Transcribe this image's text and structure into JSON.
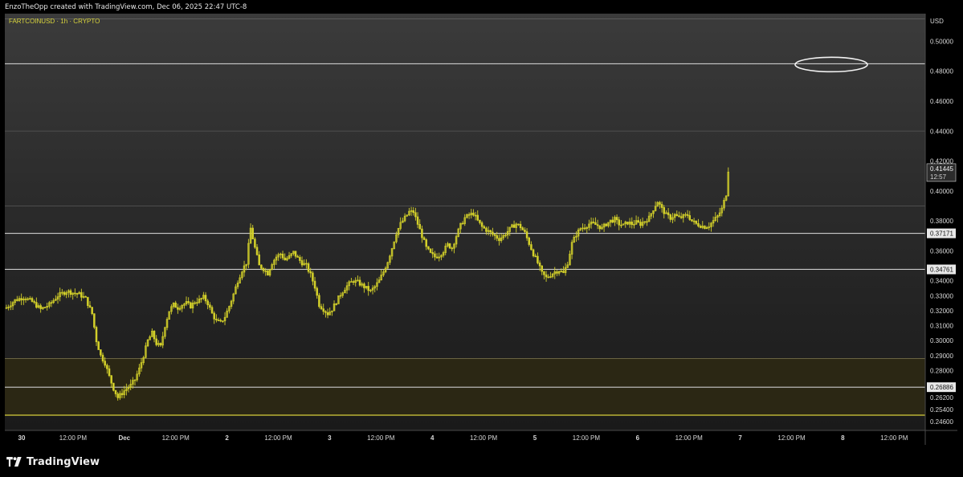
{
  "header": {
    "caption": "EnzoTheOpp created with TradingView.com, Dec 06, 2025 22:47 UTC-8"
  },
  "brand": {
    "name": "TradingView",
    "logo_icon": "tradingview-logo-icon"
  },
  "colors": {
    "candle": "#d4d12a",
    "zone": "#2b2714",
    "zone_edge": "#d8cf3a",
    "level_line": "#c9c9c9",
    "axis_text": "#d8d8d8",
    "symbol_text": "#d8d43c"
  },
  "chart_data": {
    "type": "candlestick",
    "symbol_label": "FARTCOINUSD · 1h · CRYPTO",
    "currency": "USD",
    "ylim": [
      0.24,
      0.5185
    ],
    "y_ticks": [
      "0.50000",
      "0.48000",
      "0.46000",
      "0.44000",
      "0.42000",
      "0.40000",
      "0.38000",
      "0.36000",
      "0.34000",
      "0.33000",
      "0.32000",
      "0.31000",
      "0.30000",
      "0.29000",
      "0.28000",
      "0.26200",
      "0.25400",
      "0.24600"
    ],
    "x_ticks": [
      "30",
      "12:00 PM",
      "Dec",
      "12:00 PM",
      "2",
      "12:00 PM",
      "3",
      "12:00 PM",
      "4",
      "12:00 PM",
      "5",
      "12:00 PM",
      "6",
      "12:00 PM",
      "7",
      "12:00 PM",
      "8",
      "12:00 PM"
    ],
    "current_price": {
      "price": "0.41445",
      "countdown": "12:57",
      "value": 0.41445
    },
    "level_lines": [
      {
        "price": 0.485,
        "label": ""
      },
      {
        "price": 0.3717,
        "label": "0.37171"
      },
      {
        "price": 0.3476,
        "label": "0.34761"
      },
      {
        "price": 0.2689,
        "label": "0.26886"
      }
    ],
    "demand_zone": {
      "top": 0.288,
      "bottom": 0.2502
    },
    "target_ellipse_price": 0.4845,
    "price_path": [
      [
        0,
        0.322
      ],
      [
        4,
        0.327
      ],
      [
        8,
        0.329
      ],
      [
        12,
        0.326
      ],
      [
        16,
        0.321
      ],
      [
        20,
        0.324
      ],
      [
        24,
        0.33
      ],
      [
        28,
        0.333
      ],
      [
        31,
        0.332
      ],
      [
        34,
        0.331
      ],
      [
        37,
        0.328
      ],
      [
        40,
        0.318
      ],
      [
        42,
        0.3
      ],
      [
        44,
        0.29
      ],
      [
        46,
        0.285
      ],
      [
        48,
        0.276
      ],
      [
        50,
        0.268
      ],
      [
        52,
        0.262
      ],
      [
        54,
        0.265
      ],
      [
        56,
        0.268
      ],
      [
        58,
        0.27
      ],
      [
        60,
        0.274
      ],
      [
        62,
        0.281
      ],
      [
        64,
        0.29
      ],
      [
        66,
        0.3
      ],
      [
        68,
        0.305
      ],
      [
        70,
        0.298
      ],
      [
        72,
        0.296
      ],
      [
        74,
        0.31
      ],
      [
        76,
        0.32
      ],
      [
        78,
        0.324
      ],
      [
        80,
        0.322
      ],
      [
        82,
        0.324
      ],
      [
        84,
        0.325
      ],
      [
        86,
        0.323
      ],
      [
        88,
        0.326
      ],
      [
        90,
        0.327
      ],
      [
        92,
        0.329
      ],
      [
        94,
        0.325
      ],
      [
        96,
        0.318
      ],
      [
        98,
        0.313
      ],
      [
        100,
        0.312
      ],
      [
        102,
        0.316
      ],
      [
        104,
        0.323
      ],
      [
        106,
        0.331
      ],
      [
        108,
        0.34
      ],
      [
        110,
        0.347
      ],
      [
        112,
        0.352
      ],
      [
        114,
        0.375
      ],
      [
        116,
        0.362
      ],
      [
        118,
        0.35
      ],
      [
        120,
        0.348
      ],
      [
        122,
        0.345
      ],
      [
        124,
        0.352
      ],
      [
        126,
        0.356
      ],
      [
        128,
        0.358
      ],
      [
        130,
        0.354
      ],
      [
        132,
        0.356
      ],
      [
        134,
        0.359
      ],
      [
        136,
        0.355
      ],
      [
        138,
        0.352
      ],
      [
        140,
        0.35
      ],
      [
        142,
        0.344
      ],
      [
        144,
        0.336
      ],
      [
        146,
        0.324
      ],
      [
        148,
        0.321
      ],
      [
        150,
        0.318
      ],
      [
        152,
        0.321
      ],
      [
        154,
        0.326
      ],
      [
        156,
        0.331
      ],
      [
        158,
        0.335
      ],
      [
        160,
        0.338
      ],
      [
        162,
        0.34
      ],
      [
        164,
        0.339
      ],
      [
        166,
        0.337
      ],
      [
        168,
        0.335
      ],
      [
        170,
        0.333
      ],
      [
        172,
        0.336
      ],
      [
        174,
        0.34
      ],
      [
        176,
        0.346
      ],
      [
        178,
        0.353
      ],
      [
        180,
        0.362
      ],
      [
        182,
        0.372
      ],
      [
        184,
        0.378
      ],
      [
        186,
        0.382
      ],
      [
        188,
        0.386
      ],
      [
        190,
        0.386
      ],
      [
        192,
        0.378
      ],
      [
        194,
        0.37
      ],
      [
        196,
        0.362
      ],
      [
        198,
        0.358
      ],
      [
        200,
        0.356
      ],
      [
        202,
        0.357
      ],
      [
        204,
        0.36
      ],
      [
        206,
        0.364
      ],
      [
        208,
        0.362
      ],
      [
        210,
        0.37
      ],
      [
        212,
        0.377
      ],
      [
        214,
        0.382
      ],
      [
        216,
        0.384
      ],
      [
        218,
        0.385
      ],
      [
        220,
        0.38
      ],
      [
        222,
        0.376
      ],
      [
        224,
        0.374
      ],
      [
        226,
        0.372
      ],
      [
        228,
        0.37
      ],
      [
        230,
        0.368
      ],
      [
        232,
        0.37
      ],
      [
        234,
        0.373
      ],
      [
        236,
        0.376
      ],
      [
        238,
        0.378
      ],
      [
        240,
        0.376
      ],
      [
        242,
        0.372
      ],
      [
        244,
        0.365
      ],
      [
        246,
        0.358
      ],
      [
        248,
        0.352
      ],
      [
        250,
        0.345
      ],
      [
        252,
        0.342
      ],
      [
        254,
        0.344
      ],
      [
        256,
        0.346
      ],
      [
        258,
        0.347
      ],
      [
        260,
        0.345
      ],
      [
        262,
        0.352
      ],
      [
        264,
        0.365
      ],
      [
        266,
        0.371
      ],
      [
        268,
        0.375
      ],
      [
        270,
        0.376
      ],
      [
        272,
        0.378
      ],
      [
        274,
        0.378
      ],
      [
        276,
        0.377
      ],
      [
        278,
        0.375
      ],
      [
        280,
        0.378
      ],
      [
        282,
        0.38
      ],
      [
        284,
        0.381
      ],
      [
        286,
        0.378
      ],
      [
        288,
        0.377
      ],
      [
        290,
        0.379
      ],
      [
        292,
        0.378
      ],
      [
        294,
        0.379
      ],
      [
        296,
        0.378
      ],
      [
        298,
        0.38
      ],
      [
        300,
        0.382
      ],
      [
        302,
        0.388
      ],
      [
        304,
        0.393
      ],
      [
        306,
        0.388
      ],
      [
        308,
        0.384
      ],
      [
        310,
        0.382
      ],
      [
        312,
        0.384
      ],
      [
        314,
        0.382
      ],
      [
        316,
        0.383
      ],
      [
        318,
        0.384
      ],
      [
        320,
        0.38
      ],
      [
        322,
        0.378
      ],
      [
        324,
        0.377
      ],
      [
        326,
        0.376
      ],
      [
        328,
        0.377
      ],
      [
        330,
        0.38
      ],
      [
        332,
        0.383
      ],
      [
        334,
        0.388
      ],
      [
        336,
        0.398
      ],
      [
        337,
        0.414
      ]
    ]
  }
}
